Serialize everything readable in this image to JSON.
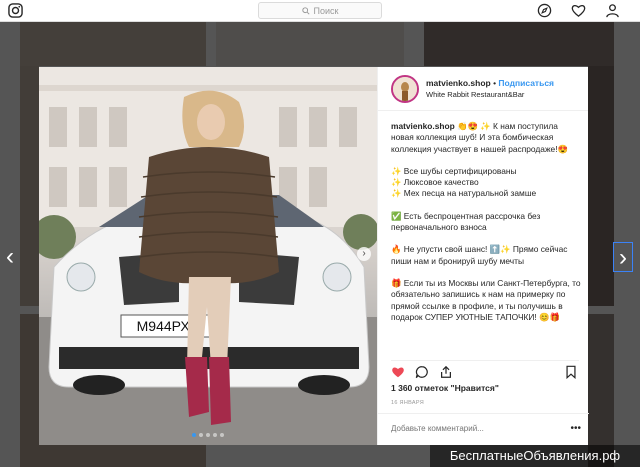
{
  "nav": {
    "search_placeholder": "Поиск"
  },
  "post": {
    "username": "matvienko.shop",
    "separator": " • ",
    "follow_label": "Подписаться",
    "location": "White Rabbit Restaurant&Bar",
    "plate": "М944РХ 7",
    "caption": {
      "p1_rest": " 👏😍 ✨ К нам поступила новая коллекция шуб! И эта бомбическая коллекция участвует в нашей распродаже!😍",
      "p2": "✨ Все шубы сертифицированы\n✨ Люксовое качество\n✨ Мех песца на натуральной замше",
      "p3": "✅ Есть беспроцентная рассрочка без первоначального взноса",
      "p4": "🔥 Не упусти свой шанс! ⬆️✨ Прямо сейчас пиши нам и бронируй шубу мечты",
      "p5": "🎁 Если ты из Москвы или Санкт-Петербурга, то обязательно запишись к нам на примерку по прямой ссылке в профиле, и ты получишь в подарок СУПЕР УЮТНЫЕ ТАПОЧКИ! 😊🎁"
    },
    "likes": "1 360 отметок \"Нравится\"",
    "date": "16 ЯНВАРЯ",
    "comment_placeholder": "Добавьте комментарий...",
    "more": "•••"
  },
  "watermark": "БесплатныеОбъявления.рф",
  "colors": {
    "accent": "#3897f0",
    "heart": "#ed4956"
  }
}
